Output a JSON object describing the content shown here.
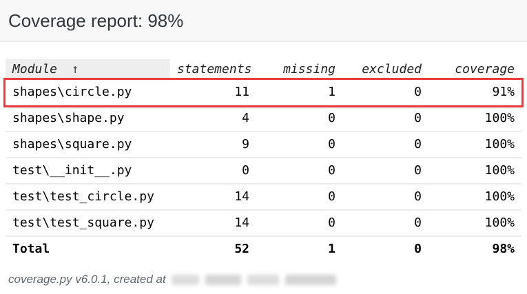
{
  "header": {
    "title": "Coverage report: 98%"
  },
  "table": {
    "columns": [
      {
        "label": "Module",
        "sorted": true,
        "sort_arrow": "↑",
        "align": "left"
      },
      {
        "label": "statements",
        "align": "right"
      },
      {
        "label": "missing",
        "align": "right"
      },
      {
        "label": "excluded",
        "align": "right"
      },
      {
        "label": "coverage",
        "align": "right"
      }
    ],
    "rows": [
      {
        "module": "shapes\\circle.py",
        "statements": "11",
        "missing": "1",
        "excluded": "0",
        "coverage": "91%",
        "highlighted": true
      },
      {
        "module": "shapes\\shape.py",
        "statements": "4",
        "missing": "0",
        "excluded": "0",
        "coverage": "100%",
        "highlighted": false
      },
      {
        "module": "shapes\\square.py",
        "statements": "9",
        "missing": "0",
        "excluded": "0",
        "coverage": "100%",
        "highlighted": false
      },
      {
        "module": "test\\__init__.py",
        "statements": "0",
        "missing": "0",
        "excluded": "0",
        "coverage": "100%",
        "highlighted": false
      },
      {
        "module": "test\\test_circle.py",
        "statements": "14",
        "missing": "0",
        "excluded": "0",
        "coverage": "100%",
        "highlighted": false
      },
      {
        "module": "test\\test_square.py",
        "statements": "14",
        "missing": "0",
        "excluded": "0",
        "coverage": "100%",
        "highlighted": false
      }
    ],
    "total": {
      "module": "Total",
      "statements": "52",
      "missing": "1",
      "excluded": "0",
      "coverage": "98%"
    }
  },
  "footer": {
    "text": "coverage.py v6.0.1, created at",
    "timestamp_redacted": true
  },
  "colors": {
    "highlight_border": "#ea3a3e",
    "header_bg": "#f8f8f8",
    "sorted_th_bg": "#eeeeee",
    "row_border": "#ececec",
    "divider": "#ececec",
    "title_color": "#30373d",
    "footer_color": "#5f676d"
  }
}
